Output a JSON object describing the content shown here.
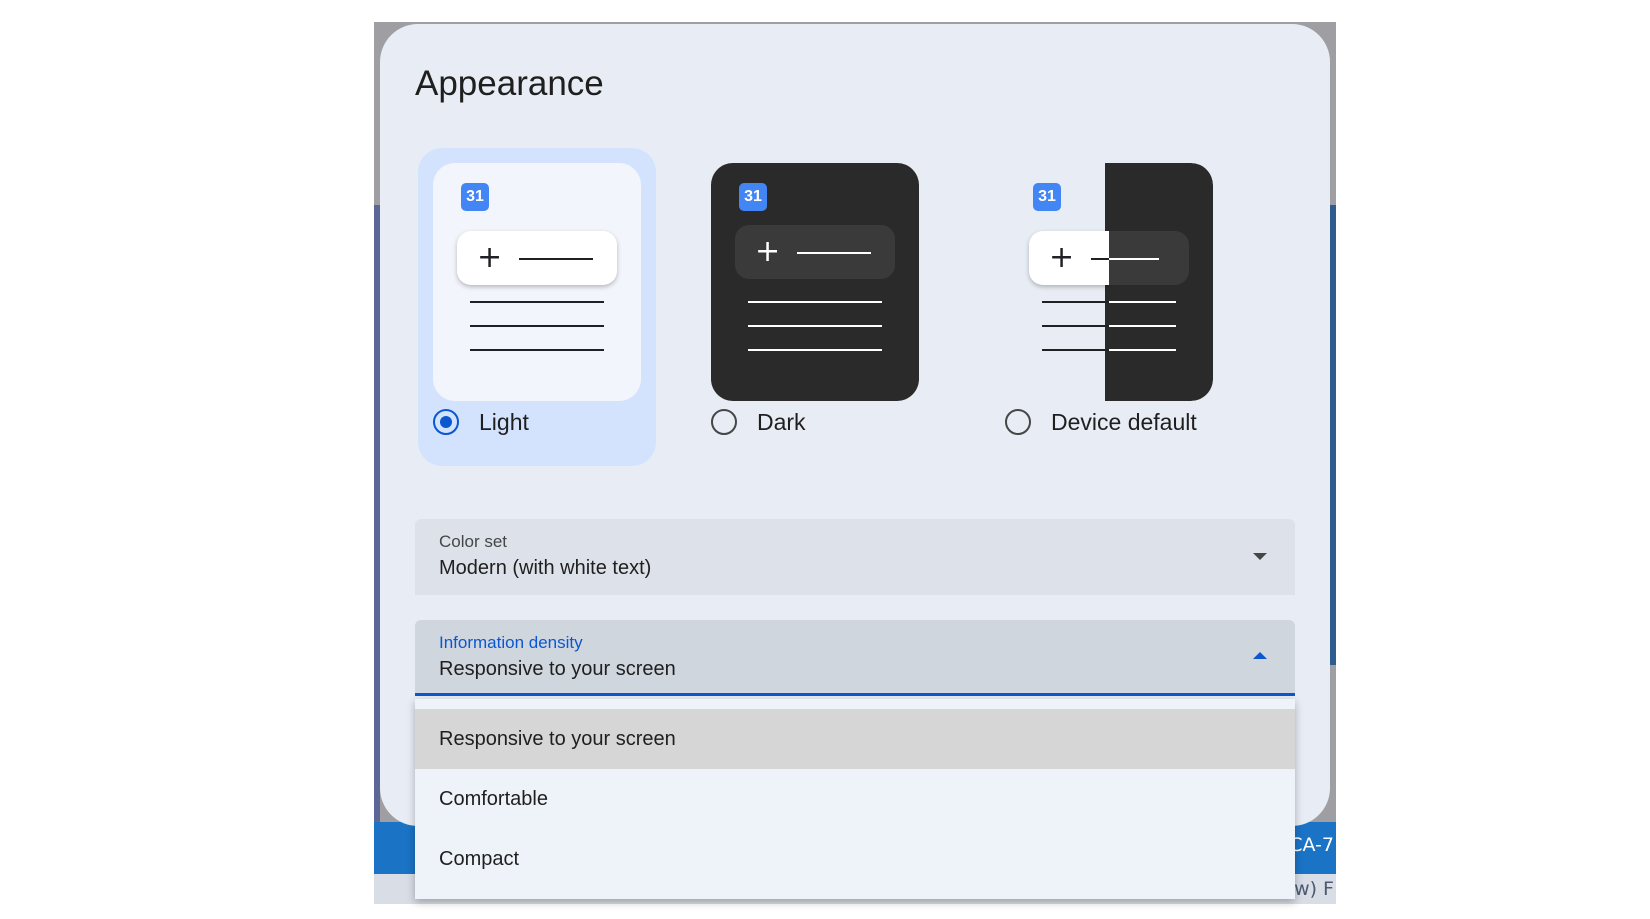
{
  "backdrop": {
    "peek_top": "CA-7",
    "peek_bottom": "(w) F"
  },
  "dialog": {
    "title": "Appearance",
    "themes": [
      {
        "label": "Light",
        "icon_day": "31",
        "selected": true
      },
      {
        "label": "Dark",
        "icon_day": "31",
        "selected": false
      },
      {
        "label": "Device default",
        "icon_day": "31",
        "selected": false
      }
    ],
    "color_set": {
      "label": "Color set",
      "value": "Modern (with white text)"
    },
    "information_density": {
      "label": "Information density",
      "value": "Responsive to your screen",
      "options": [
        "Responsive to your screen",
        "Comfortable",
        "Compact"
      ],
      "highlighted_option": "Responsive to your screen"
    }
  },
  "colors": {
    "accent": "#0b57d0",
    "selected_theme_bg": "#d3e3fd",
    "dialog_bg": "#e8edf5",
    "calendar_icon": "#4285f4"
  }
}
